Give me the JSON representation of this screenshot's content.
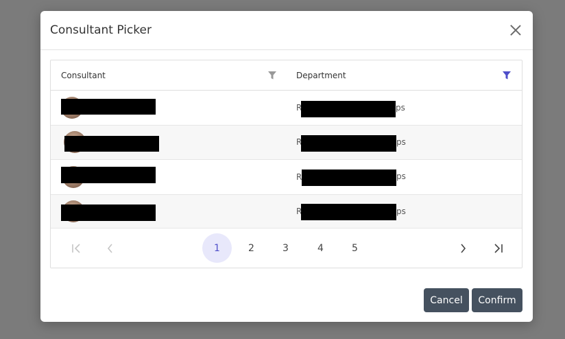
{
  "dialog": {
    "title": "Consultant Picker",
    "close_icon": "close-icon"
  },
  "table": {
    "columns": [
      {
        "label": "Consultant",
        "filter_icon": "filter-icon",
        "filter_active": false
      },
      {
        "label": "Department",
        "filter_icon": "filter-icon",
        "filter_active": true
      }
    ],
    "rows": [
      {
        "dept_prefix": "R",
        "dept_suffix": "ps"
      },
      {
        "dept_prefix": "R",
        "dept_suffix": "ps"
      },
      {
        "dept_prefix": "R",
        "dept_suffix": "ps"
      },
      {
        "dept_prefix": "R",
        "dept_suffix": "ps"
      }
    ]
  },
  "pagination": {
    "pages": [
      "1",
      "2",
      "3",
      "4",
      "5"
    ],
    "current_page": "1",
    "first_icon": "first-page-icon",
    "prev_icon": "chevron-left-icon",
    "next_icon": "chevron-right-icon",
    "last_icon": "last-page-icon"
  },
  "actions": {
    "cancel_label": "Cancel",
    "confirm_label": "Confirm"
  },
  "colors": {
    "accent": "#4e4ec9",
    "active_page_bg": "#e8e8fb",
    "button_bg": "#45515f",
    "overlay": "#7b7b7b"
  }
}
